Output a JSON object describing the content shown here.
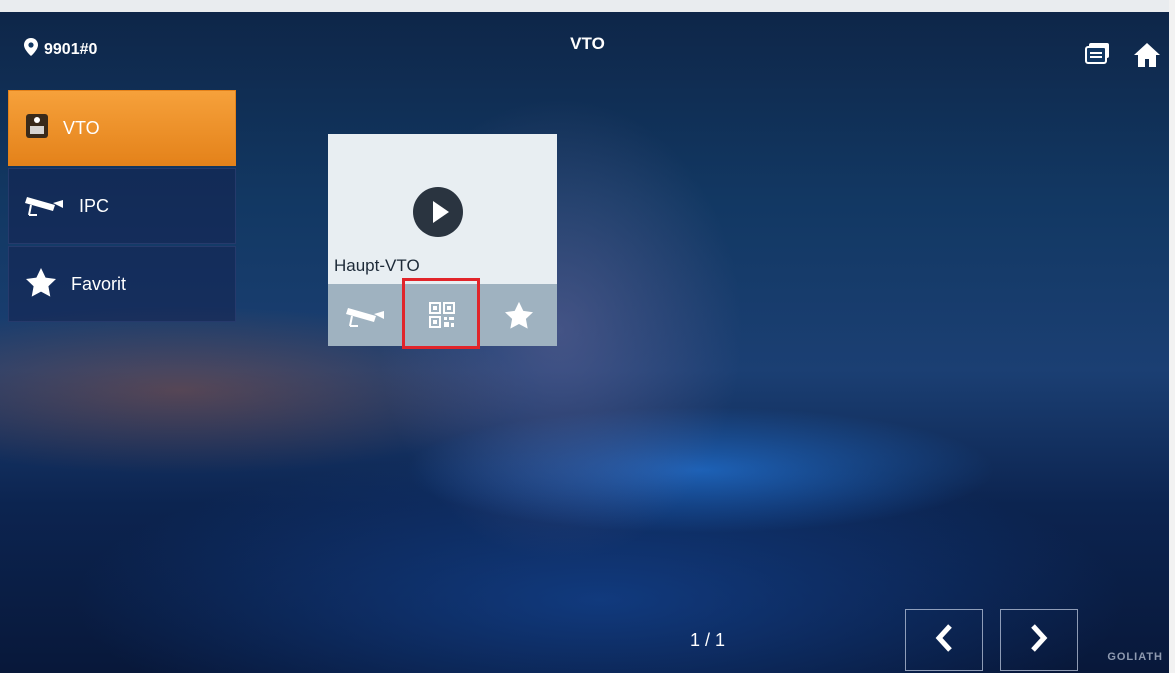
{
  "header": {
    "location": "9901#0",
    "title": "VTO",
    "icons": [
      "map-pin-icon",
      "message-icon",
      "home-icon"
    ]
  },
  "sidebar": {
    "items": [
      {
        "label": "VTO",
        "icon": "door-station-icon",
        "active": true
      },
      {
        "label": "IPC",
        "icon": "camera-icon",
        "active": false
      },
      {
        "label": "Favorit",
        "icon": "star-icon",
        "active": false
      }
    ]
  },
  "card": {
    "name": "Haupt-VTO",
    "actions": [
      "camera-icon",
      "qr-code-icon",
      "star-icon"
    ]
  },
  "pagination": {
    "page": "1 / 1"
  },
  "brand": "GOLIATH",
  "colors": {
    "active": "#f39a2f",
    "highlight": "#e1242a",
    "card": "#e8eef2",
    "card_actions": "#9fb2c0"
  }
}
